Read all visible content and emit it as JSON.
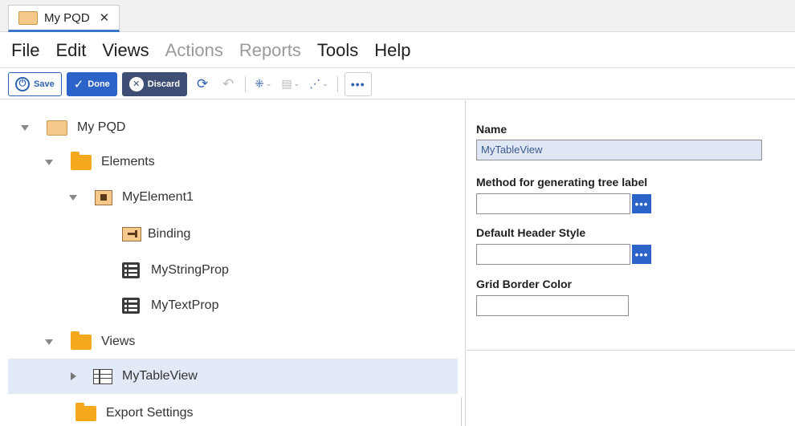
{
  "tab": {
    "title": "My PQD",
    "close_glyph": "✕",
    "icon": "folder-icon"
  },
  "menu": [
    {
      "label": "File",
      "enabled": true
    },
    {
      "label": "Edit",
      "enabled": true
    },
    {
      "label": "Views",
      "enabled": true
    },
    {
      "label": "Actions",
      "enabled": false
    },
    {
      "label": "Reports",
      "enabled": false
    },
    {
      "label": "Tools",
      "enabled": true
    },
    {
      "label": "Help",
      "enabled": true
    }
  ],
  "toolbar": {
    "save_label": "Save",
    "done_label": "Done",
    "discard_label": "Discard",
    "done_color": "#2c63c9",
    "discard_color": "#3d4f74",
    "icons": [
      "refresh-icon",
      "undo-icon",
      "network-icon",
      "clipboard-icon",
      "connect-icon",
      "more-icon"
    ]
  },
  "tree": {
    "root": "My PQD",
    "elements_folder": "Elements",
    "element": "MyElement1",
    "binding": "Binding",
    "string_prop": "MyStringProp",
    "text_prop": "MyTextProp",
    "views_folder": "Views",
    "view": "MyTableView",
    "export": "Export Settings",
    "selected_color": "#e3eaf7"
  },
  "properties": {
    "name_label": "Name",
    "name_value": "MyTableView",
    "tree_label_label": "Method for generating tree label",
    "tree_label_value": "",
    "header_style_label": "Default Header Style",
    "header_style_value": "",
    "grid_border_label": "Grid Border Color",
    "grid_border_value": ""
  }
}
